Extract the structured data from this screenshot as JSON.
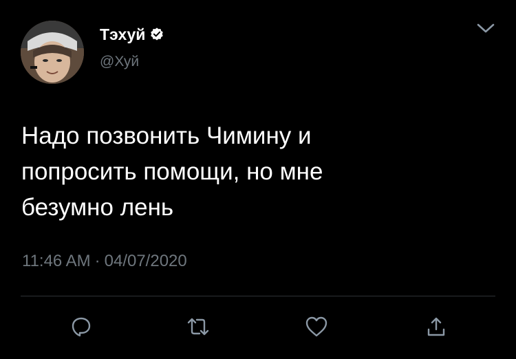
{
  "tweet": {
    "display_name": "Тэхуй",
    "handle": "@Хуй",
    "text": "Надо позвонить Чимину и\nпопросить помощи, но мне\nбезумно лень",
    "time": "11:46 AM",
    "separator": "·",
    "date": "04/07/2020"
  },
  "icons": {
    "verified": "verified-badge-icon",
    "more": "chevron-down-icon",
    "reply": "reply-icon",
    "retweet": "retweet-icon",
    "like": "heart-icon",
    "share": "share-icon"
  },
  "colors": {
    "background": "#000000",
    "text": "#ffffff",
    "secondary": "#6e767d",
    "divider": "#2f3336"
  }
}
